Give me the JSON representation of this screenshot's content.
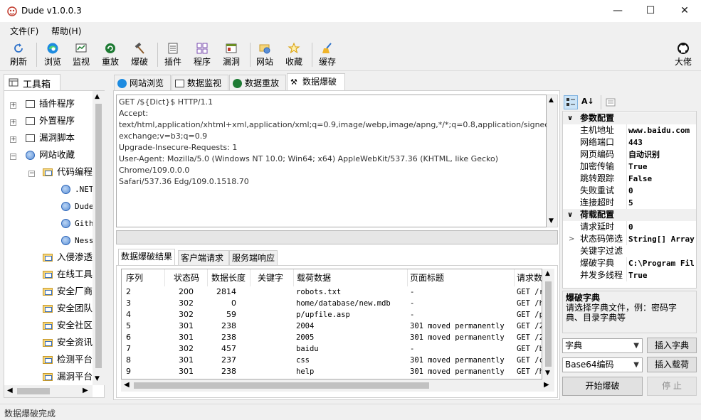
{
  "window": {
    "title": "Dude v1.0.0.3",
    "minimize": "—",
    "maximize": "☐",
    "close": "✕"
  },
  "menu": {
    "file": "文件(F)",
    "help": "帮助(H)"
  },
  "toolbar": {
    "refresh": "刷新",
    "browse": "浏览",
    "monitor": "监视",
    "replay": "重放",
    "bruteforce": "爆破",
    "plugin": "插件",
    "program": "程序",
    "vuln": "漏洞",
    "website": "网站",
    "favorite": "收藏",
    "cache": "缓存",
    "author": "大佬"
  },
  "left_panel": {
    "tab": "工具箱",
    "tree": [
      {
        "label": "插件程序"
      },
      {
        "label": "外置程序"
      },
      {
        "label": "漏洞脚本"
      },
      {
        "label": "网站收藏"
      },
      {
        "label": "代码编程"
      },
      {
        "label": ".NET"
      },
      {
        "label": "Dude"
      },
      {
        "label": "Gith"
      },
      {
        "label": "Ness"
      },
      {
        "label": "入侵渗透"
      },
      {
        "label": "在线工具"
      },
      {
        "label": "安全厂商"
      },
      {
        "label": "安全团队"
      },
      {
        "label": "安全社区"
      },
      {
        "label": "安全资讯"
      },
      {
        "label": "检测平台"
      },
      {
        "label": "漏洞平台"
      }
    ]
  },
  "center_tabs": {
    "browse": "网站浏览",
    "monitor": "数据监视",
    "replay": "数据重放",
    "brute": "数据爆破"
  },
  "request": {
    "lines": [
      "GET /${Dict}$ HTTP/1.1",
      "Accept: text/html,application/xhtml+xml,application/xml;q=0.9,image/webp,image/apng,*/*;q=0.8,application/signed-",
      "exchange;v=b3;q=0.9",
      "Upgrade-Insecure-Requests: 1",
      "User-Agent: Mozilla/5.0 (Windows NT 10.0; Win64; x64) AppleWebKit/537.36 (KHTML, like Gecko) Chrome/109.0.0.0",
      "Safari/537.36 Edg/109.0.1518.70"
    ]
  },
  "bottom_tabs": {
    "results": "数据爆破结果",
    "client": "客户端请求",
    "server": "服务端响应"
  },
  "results": {
    "columns": [
      "序列",
      "状态码",
      "数据长度",
      "关键字",
      "载荷数据",
      "页面标题",
      "请求数"
    ],
    "rows": [
      {
        "seq": "2",
        "status": "200",
        "length": "2814",
        "keyword": "",
        "payload": "robots.txt",
        "title": "-",
        "req": "GET /r"
      },
      {
        "seq": "3",
        "status": "302",
        "length": "0",
        "keyword": "",
        "payload": "home/database/new.mdb",
        "title": "-",
        "req": "GET /h"
      },
      {
        "seq": "4",
        "status": "302",
        "length": "59",
        "keyword": "",
        "payload": "p/upfile.asp",
        "title": "-",
        "req": "GET /p"
      },
      {
        "seq": "5",
        "status": "301",
        "length": "238",
        "keyword": "",
        "payload": "2004",
        "title": "301 moved permanently",
        "req": "GET /2"
      },
      {
        "seq": "6",
        "status": "301",
        "length": "238",
        "keyword": "",
        "payload": "2005",
        "title": "301 moved permanently",
        "req": "GET /2"
      },
      {
        "seq": "7",
        "status": "302",
        "length": "457",
        "keyword": "",
        "payload": "baidu",
        "title": "-",
        "req": "GET /b"
      },
      {
        "seq": "8",
        "status": "301",
        "length": "237",
        "keyword": "",
        "payload": "css",
        "title": "301 moved permanently",
        "req": "GET /c"
      },
      {
        "seq": "9",
        "status": "301",
        "length": "238",
        "keyword": "",
        "payload": "help",
        "title": "301 moved permanently",
        "req": "GET /h"
      }
    ]
  },
  "properties": {
    "cat1": "参数配置",
    "cat2": "荷载配置",
    "rows1": [
      {
        "name": "主机地址",
        "value": "www.baidu.com"
      },
      {
        "name": "网络端口",
        "value": "443"
      },
      {
        "name": "网页编码",
        "value": "自动识别"
      },
      {
        "name": "加密传输",
        "value": "True"
      },
      {
        "name": "跳转跟踪",
        "value": "False"
      },
      {
        "name": "失败重试",
        "value": "0"
      },
      {
        "name": "连接超时",
        "value": "5"
      }
    ],
    "rows2": [
      {
        "name": "请求延时",
        "value": "0"
      },
      {
        "name": "状态码筛选",
        "value": "String[] Array"
      },
      {
        "name": "关键字过滤",
        "value": ""
      },
      {
        "name": "爆破字典",
        "value": "C:\\Program Fil"
      },
      {
        "name": "并发多线程",
        "value": "True"
      }
    ]
  },
  "help": {
    "title": "爆破字典",
    "text": "请选择字典文件，例：密码字典、目录字典等"
  },
  "controls": {
    "dict_combo": "字典",
    "encode_combo": "Base64编码",
    "insert_dict": "插入字典",
    "insert_payload": "插入载荷",
    "start": "开始爆破",
    "stop": "停 止"
  },
  "status": {
    "text": "数据爆破完成"
  },
  "colors": {
    "accent": "#0078d7",
    "panel": "#f0f0f0"
  }
}
